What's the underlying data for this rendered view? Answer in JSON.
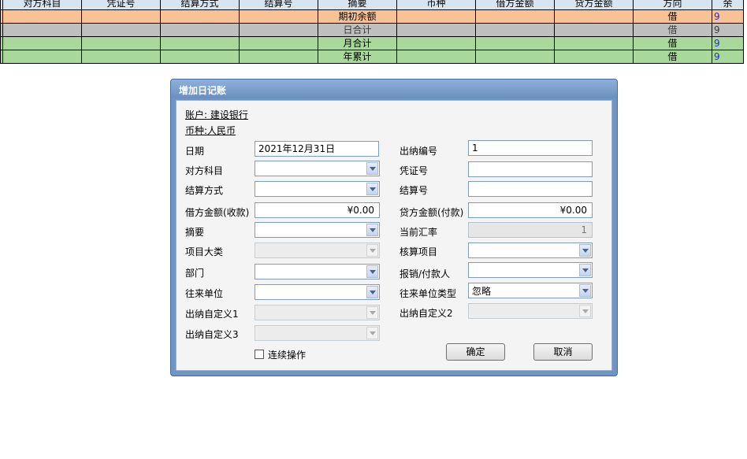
{
  "ledger": {
    "headers": [
      "",
      "对方科目",
      "凭证号",
      "结算方式",
      "结算号",
      "摘要",
      "币种",
      "借方金额",
      "贷方金额",
      "方向",
      "余"
    ],
    "rows": [
      {
        "summary": "期初余额",
        "direction": "借",
        "balance": "9"
      },
      {
        "summary": "日合计",
        "direction": "借",
        "balance": "9"
      },
      {
        "summary": "月合计",
        "direction": "借",
        "balance": "9"
      },
      {
        "summary": "年累计",
        "direction": "借",
        "balance": "9"
      }
    ]
  },
  "dialog": {
    "title": "增加日记账",
    "account": "账户: 建设银行",
    "currency": "币种:人民币",
    "left": {
      "date_label": "日期",
      "date_value": "2021年12月31日",
      "counter_subject_label": "对方科目",
      "settle_method_label": "结算方式",
      "debit_label": "借方金额(收款)",
      "debit_value": "¥0.00",
      "summary_label": "摘要",
      "project_class_label": "项目大类",
      "dept_label": "部门",
      "partner_label": "往来单位",
      "custom1_label": "出纳自定义1",
      "custom3_label": "出纳自定义3",
      "continuous_label": "连续操作"
    },
    "right": {
      "cashier_no_label": "出纳编号",
      "cashier_no_value": "1",
      "voucher_no_label": "凭证号",
      "settle_no_label": "结算号",
      "credit_label": "贷方金额(付款)",
      "credit_value": "¥0.00",
      "rate_label": "当前汇率",
      "rate_value": "1",
      "accounting_item_label": "核算项目",
      "payee_label": "报销/付款人",
      "partner_type_label": "往来单位类型",
      "partner_type_value": "忽略",
      "custom2_label": "出纳自定义2"
    },
    "ok_label": "确定",
    "cancel_label": "取消"
  }
}
